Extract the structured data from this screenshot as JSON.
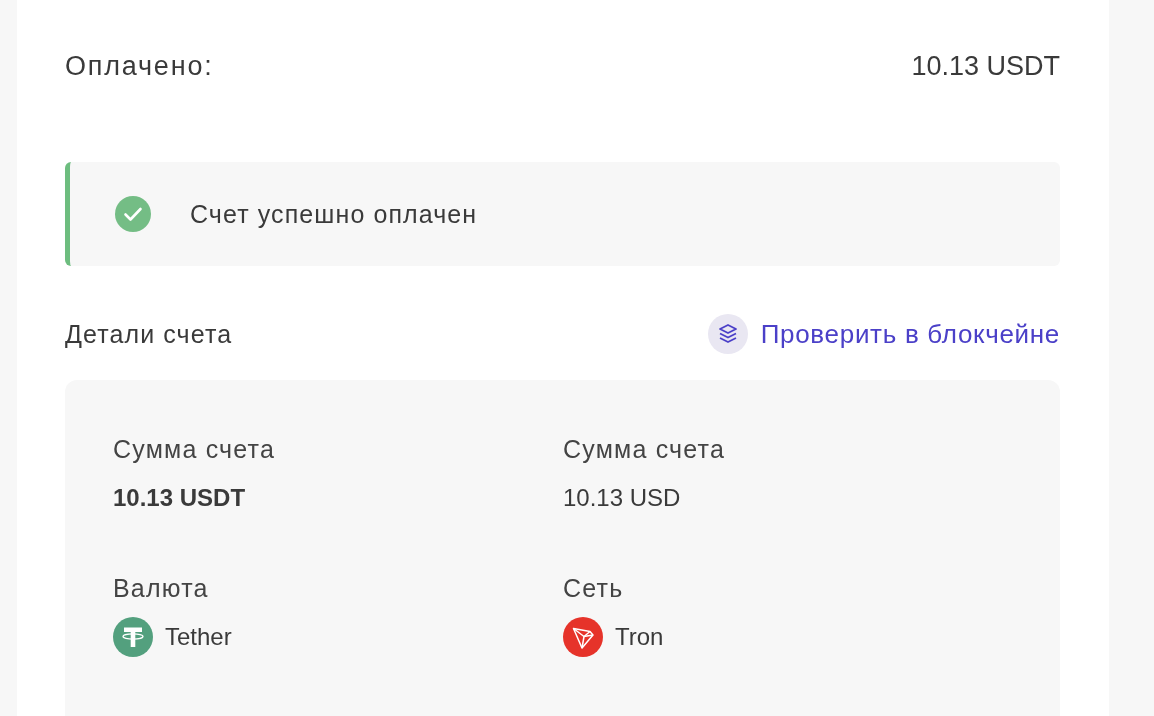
{
  "paid": {
    "label": "Оплачено:",
    "value": "10.13 USDT"
  },
  "status_alert": {
    "kind": "success",
    "text": "Счет успешно оплачен"
  },
  "details": {
    "title": "Детали счета",
    "blockchain_link": "Проверить в блокчейне",
    "fields": [
      {
        "kind": "primary_amount",
        "label": "Сумма счета",
        "value": "10.13 USDT"
      },
      {
        "kind": "amount",
        "label": "Сумма счета",
        "value": "10.13 USD"
      },
      {
        "kind": "token",
        "label": "Валюта",
        "value": "Tether"
      },
      {
        "kind": "network",
        "label": "Сеть",
        "value": "Tron"
      }
    ]
  }
}
